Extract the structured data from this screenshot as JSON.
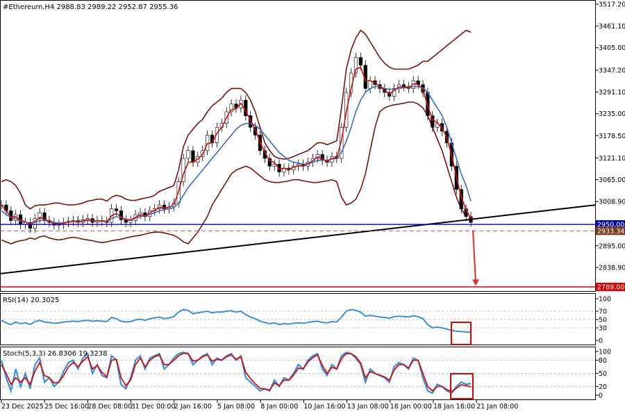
{
  "header": {
    "symbol_line": "#Ethereum,H4  2988.83 2989.22 2952.87 2955.36",
    "rsi_line": "RSI(14) 20.3025",
    "stoch_line": "Stoch(5,3,3) 26.8306 19.3238"
  },
  "chart_data": [
    {
      "type": "line",
      "title": "#Ethereum,H4",
      "ylim": [
        2789,
        3517.2
      ],
      "y_ticks": [
        "3517.20",
        "3461.10",
        "3405.00",
        "3347.20",
        "3291.10",
        "3235.00",
        "3178.50",
        "3121.10",
        "3065.00",
        "3008.90",
        "2895.00",
        "2838.90"
      ],
      "price_labels": [
        {
          "label": "2950.00",
          "color": "#0000b0"
        },
        {
          "label": "2933.34",
          "color": "#7a3b1e"
        },
        {
          "label": "2789.00",
          "color": "#e00000"
        }
      ],
      "horizontal_levels": [
        {
          "value": 2950.0,
          "color": "#0000b0",
          "style": "solid"
        },
        {
          "value": 2933.34,
          "color": "#a0522d",
          "style": "dashed"
        },
        {
          "value": 2789.0,
          "color": "#e00000",
          "style": "solid"
        }
      ],
      "x_labels": [
        "23 Dec 2025",
        "25 Dec 16:00",
        "28 Dec 08:00",
        "31 Dec 00:00",
        "2 Jan 16:00",
        "5 Jan 08:00",
        "8 Jan 00:00",
        "10 Jan 16:00",
        "13 Jan 08:00",
        "16 Jan 00:00",
        "18 Jan 16:00",
        "21 Jan 08:00"
      ],
      "close": [
        3000,
        2985,
        2960,
        2975,
        2950,
        2955,
        2940,
        2965,
        2980,
        2960,
        2955,
        2948,
        2950,
        2955,
        2958,
        2960,
        2955,
        2962,
        2965,
        2955,
        2960,
        2958,
        2955,
        2990,
        2985,
        2962,
        2955,
        2960,
        2975,
        2980,
        2970,
        2985,
        2990,
        3000,
        2990,
        2995,
        3005,
        3060,
        3120,
        3140,
        3110,
        3125,
        3140,
        3180,
        3160,
        3200,
        3210,
        3240,
        3260,
        3250,
        3270,
        3230,
        3200,
        3180,
        3140,
        3120,
        3100,
        3105,
        3085,
        3095,
        3090,
        3100,
        3105,
        3100,
        3110,
        3120,
        3130,
        3115,
        3110,
        3125,
        3120,
        3200,
        3290,
        3340,
        3380,
        3360,
        3300,
        3320,
        3310,
        3300,
        3290,
        3280,
        3300,
        3310,
        3305,
        3300,
        3320,
        3310,
        3290,
        3230,
        3200,
        3210,
        3190,
        3160,
        3100,
        3040,
        2990,
        2970,
        2955
      ],
      "series": [
        {
          "name": "",
          "values": [
            2985,
            2975,
            2968,
            2965,
            2958,
            2956,
            2952,
            2955,
            2960,
            2960,
            2958,
            2955,
            2953,
            2954,
            2956,
            2958,
            2957,
            2958,
            2960,
            2960,
            2959,
            2959,
            2958,
            2965,
            2970,
            2967,
            2963,
            2962,
            2966,
            2970,
            2972,
            2976,
            2980,
            2985,
            2988,
            2990,
            2993,
            3005,
            3025,
            3045,
            3060,
            3075,
            3090,
            3105,
            3120,
            3135,
            3150,
            3165,
            3180,
            3195,
            3205,
            3210,
            3210,
            3205,
            3195,
            3180,
            3165,
            3150,
            3135,
            3125,
            3115,
            3110,
            3108,
            3105,
            3106,
            3110,
            3115,
            3115,
            3115,
            3118,
            3120,
            3135,
            3165,
            3200,
            3240,
            3270,
            3290,
            3300,
            3305,
            3305,
            3300,
            3298,
            3298,
            3300,
            3302,
            3302,
            3305,
            3305,
            3302,
            3290,
            3270,
            3250,
            3230,
            3200,
            3160,
            3120,
            3080,
            3050,
            3010
          ],
          "color": "#3a6bc4"
        },
        {
          "name": "",
          "values": [
            3000,
            2985,
            2968,
            2970,
            2960,
            2957,
            2950,
            2958,
            2968,
            2963,
            2958,
            2952,
            2951,
            2953,
            2956,
            2958,
            2956,
            2959,
            2962,
            2959,
            2959,
            2958,
            2957,
            2972,
            2978,
            2969,
            2962,
            2961,
            2968,
            2975,
            2972,
            2980,
            2986,
            2994,
            2992,
            2994,
            3001,
            3035,
            3080,
            3110,
            3110,
            3118,
            3130,
            3158,
            3160,
            3185,
            3200,
            3225,
            3245,
            3248,
            3262,
            3242,
            3218,
            3195,
            3162,
            3136,
            3114,
            3109,
            3093,
            3094,
            3092,
            3097,
            3101,
            3100,
            3106,
            3114,
            3124,
            3118,
            3113,
            3120,
            3120,
            3168,
            3240,
            3300,
            3350,
            3355,
            3320,
            3320,
            3315,
            3305,
            3295,
            3286,
            3295,
            3304,
            3304,
            3301,
            3312,
            3310,
            3297,
            3255,
            3220,
            3212,
            3198,
            3174,
            3128,
            3072,
            3020,
            2988,
            2965
          ],
          "color": "#d01010"
        }
      ],
      "bollinger": {
        "upper": [
          3060,
          3065,
          3060,
          3050,
          3030,
          3000,
          2990,
          2998,
          3000,
          3000,
          3002,
          3005,
          3005,
          3002,
          3000,
          3000,
          3002,
          3005,
          3010,
          3012,
          3015,
          3015,
          3010,
          3020,
          3025,
          3022,
          3015,
          3012,
          3012,
          3015,
          3018,
          3020,
          3025,
          3035,
          3040,
          3045,
          3050,
          3090,
          3150,
          3180,
          3195,
          3210,
          3220,
          3240,
          3255,
          3265,
          3275,
          3290,
          3300,
          3300,
          3300,
          3290,
          3270,
          3240,
          3200,
          3160,
          3140,
          3125,
          3120,
          3118,
          3120,
          3125,
          3130,
          3135,
          3140,
          3150,
          3160,
          3160,
          3155,
          3160,
          3165,
          3250,
          3350,
          3400,
          3430,
          3450,
          3440,
          3420,
          3400,
          3380,
          3365,
          3355,
          3350,
          3350,
          3350,
          3350,
          3355,
          3360,
          3370,
          3370,
          3380,
          3390,
          3400,
          3410,
          3420,
          3430,
          3440,
          3450,
          3445
        ],
        "lower": [
          2910,
          2905,
          2900,
          2905,
          2908,
          2910,
          2915,
          2912,
          2918,
          2920,
          2915,
          2912,
          2910,
          2912,
          2915,
          2917,
          2915,
          2912,
          2910,
          2908,
          2905,
          2903,
          2905,
          2908,
          2910,
          2912,
          2915,
          2918,
          2920,
          2922,
          2925,
          2928,
          2930,
          2930,
          2928,
          2925,
          2922,
          2915,
          2905,
          2900,
          2915,
          2930,
          2950,
          2970,
          3000,
          3020,
          3040,
          3060,
          3080,
          3090,
          3095,
          3100,
          3095,
          3085,
          3075,
          3065,
          3060,
          3058,
          3058,
          3060,
          3062,
          3065,
          3065,
          3062,
          3060,
          3058,
          3058,
          3060,
          3062,
          3065,
          3060,
          3020,
          3000,
          3005,
          3015,
          3040,
          3080,
          3140,
          3200,
          3240,
          3250,
          3255,
          3258,
          3260,
          3262,
          3265,
          3265,
          3260,
          3250,
          3230,
          3200,
          3170,
          3140,
          3100,
          3060,
          3020,
          2990,
          2970
        ]
      }
    },
    {
      "type": "line",
      "title": "RSI(14) 20.3025",
      "ylim": [
        0,
        100
      ],
      "y_ticks": [
        "100",
        "70",
        "50",
        "30",
        "0"
      ],
      "series": [
        {
          "name": "",
          "color": "#3a8fd6",
          "values": [
            48,
            42,
            38,
            44,
            40,
            42,
            38,
            45,
            48,
            44,
            43,
            41,
            42,
            44,
            45,
            46,
            45,
            47,
            48,
            46,
            47,
            46,
            45,
            55,
            52,
            46,
            44,
            45,
            49,
            51,
            48,
            52,
            54,
            56,
            52,
            54,
            57,
            68,
            74,
            72,
            64,
            66,
            68,
            70,
            66,
            68,
            68,
            70,
            71,
            68,
            70,
            62,
            56,
            52,
            46,
            43,
            40,
            42,
            38,
            40,
            39,
            41,
            42,
            41,
            43,
            45,
            46,
            43,
            42,
            45,
            44,
            56,
            70,
            74,
            72,
            68,
            58,
            60,
            58,
            56,
            55,
            53,
            57,
            58,
            57,
            56,
            59,
            57,
            52,
            38,
            30,
            32,
            30,
            27,
            24,
            22,
            21,
            20,
            20
          ]
        }
      ]
    },
    {
      "type": "line",
      "title": "Stoch(5,3,3) 26.8306 19.3238",
      "ylim": [
        0,
        100
      ],
      "y_ticks": [
        "100",
        "80",
        "50",
        "20",
        "0"
      ],
      "series": [
        {
          "name": "",
          "color": "#3a8fd6",
          "values": [
            80,
            40,
            10,
            60,
            20,
            50,
            15,
            70,
            85,
            30,
            40,
            20,
            30,
            55,
            75,
            80,
            60,
            85,
            95,
            50,
            70,
            45,
            40,
            90,
            80,
            25,
            15,
            40,
            80,
            90,
            60,
            85,
            90,
            95,
            60,
            70,
            85,
            95,
            98,
            95,
            70,
            80,
            90,
            95,
            70,
            85,
            80,
            90,
            95,
            80,
            90,
            40,
            30,
            20,
            10,
            15,
            10,
            35,
            20,
            40,
            35,
            50,
            70,
            60,
            80,
            90,
            95,
            60,
            45,
            70,
            60,
            90,
            98,
            95,
            85,
            70,
            30,
            60,
            50,
            45,
            40,
            30,
            65,
            75,
            70,
            60,
            85,
            80,
            40,
            10,
            5,
            25,
            20,
            10,
            5,
            20,
            30,
            25,
            27
          ]
        },
        {
          "name": "",
          "color": "#d01010",
          "values": [
            70,
            50,
            25,
            40,
            30,
            40,
            25,
            55,
            75,
            45,
            40,
            28,
            30,
            45,
            65,
            75,
            65,
            78,
            88,
            60,
            68,
            52,
            42,
            80,
            82,
            40,
            22,
            35,
            70,
            85,
            65,
            80,
            88,
            92,
            70,
            70,
            80,
            90,
            96,
            95,
            78,
            80,
            88,
            92,
            78,
            82,
            80,
            88,
            92,
            82,
            88,
            52,
            38,
            26,
            16,
            14,
            12,
            28,
            22,
            35,
            34,
            46,
            62,
            60,
            76,
            86,
            92,
            68,
            50,
            64,
            60,
            84,
            95,
            95,
            88,
            74,
            40,
            54,
            50,
            46,
            42,
            34,
            58,
            70,
            70,
            62,
            80,
            80,
            50,
            20,
            10,
            20,
            20,
            13,
            8,
            16,
            24,
            22,
            19
          ]
        }
      ]
    }
  ]
}
